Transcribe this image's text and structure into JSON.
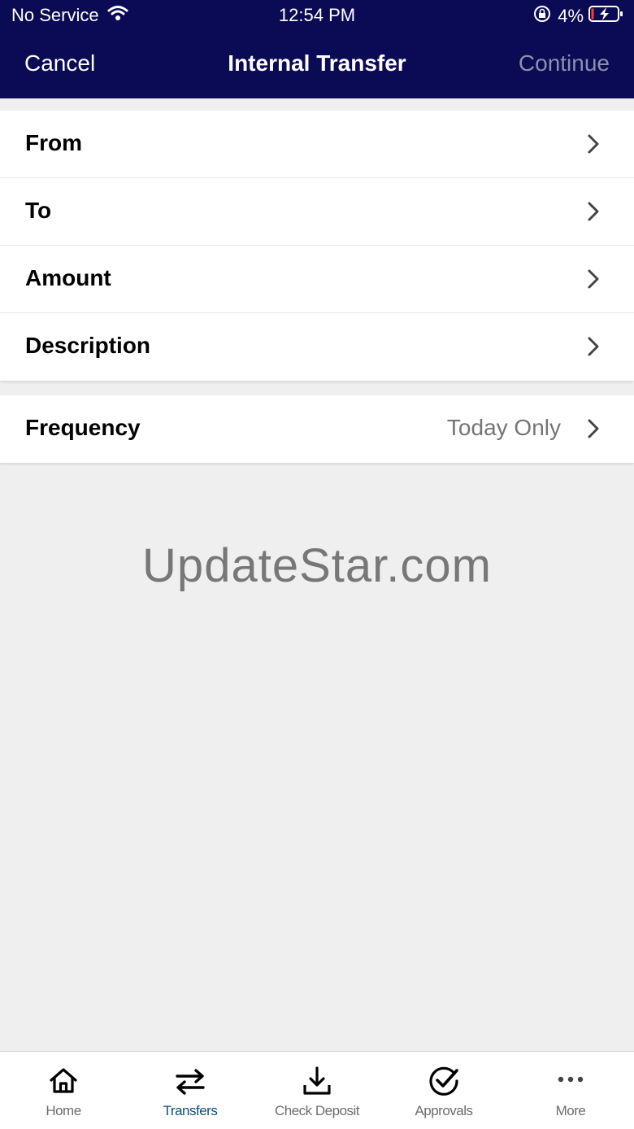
{
  "status_bar": {
    "carrier": "No Service",
    "time": "12:54 PM",
    "battery": "4%"
  },
  "nav": {
    "cancel_label": "Cancel",
    "title": "Internal Transfer",
    "continue_label": "Continue"
  },
  "form": {
    "rows": [
      {
        "label": "From"
      },
      {
        "label": "To"
      },
      {
        "label": "Amount"
      },
      {
        "label": "Description"
      }
    ],
    "frequency": {
      "label": "Frequency",
      "value": "Today Only"
    }
  },
  "watermark": "UpdateStar.com",
  "tabbar": {
    "tabs": [
      {
        "label": "Home",
        "icon": "home-icon"
      },
      {
        "label": "Transfers",
        "icon": "transfer-arrows-icon",
        "active": true
      },
      {
        "label": "Check Deposit",
        "icon": "download-tray-icon"
      },
      {
        "label": "Approvals",
        "icon": "check-circle-icon"
      },
      {
        "label": "More",
        "icon": "more-dots-icon"
      }
    ]
  },
  "colors": {
    "header_bg": "#0b0b55",
    "active_tab": "#0a4f7a",
    "inactive_tab": "#6d6d6d",
    "continue_disabled": "#8e8eb0"
  }
}
